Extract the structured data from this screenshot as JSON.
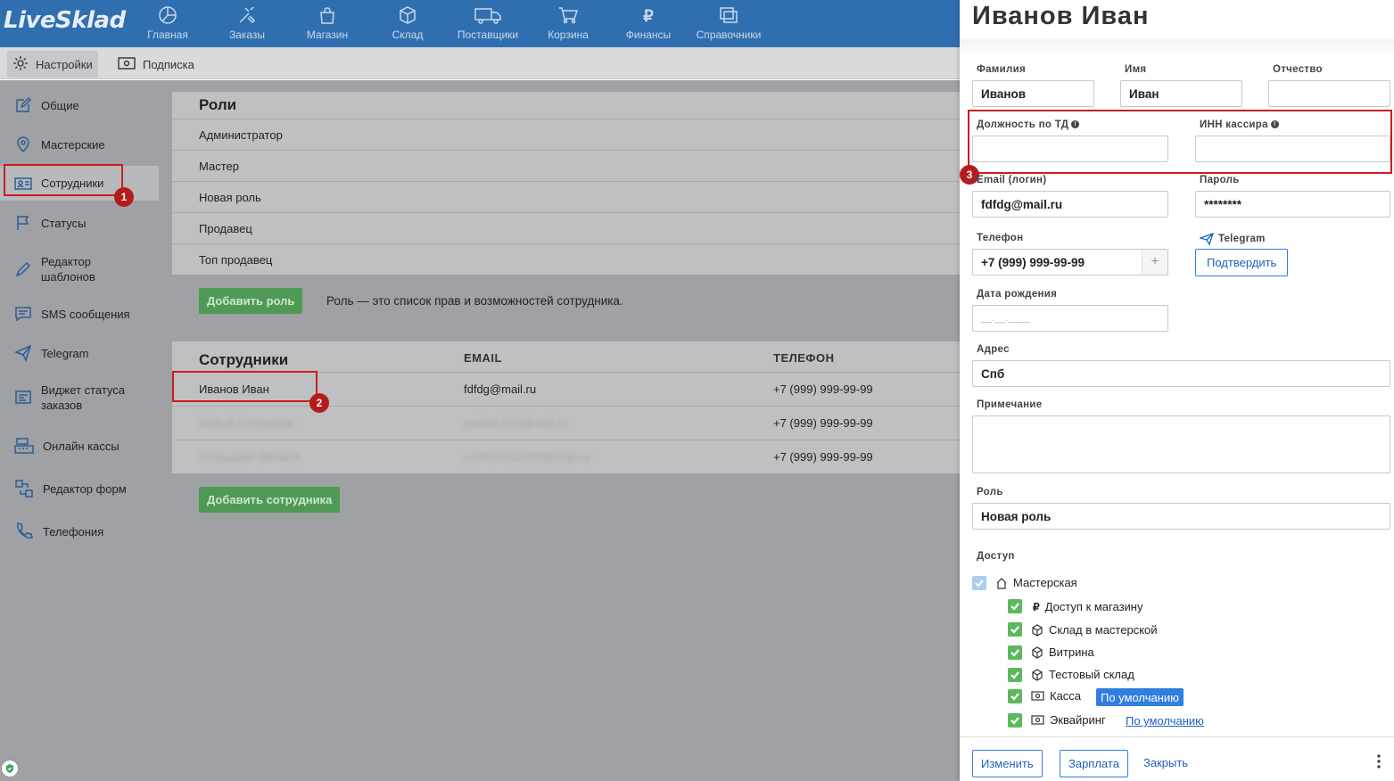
{
  "app": {
    "logo": "LiveSklad"
  },
  "nav": [
    {
      "label": "Главная",
      "icon": "pie-chart-icon"
    },
    {
      "label": "Заказы",
      "icon": "tools-icon"
    },
    {
      "label": "Магазин",
      "icon": "bag-icon"
    },
    {
      "label": "Склад",
      "icon": "box-icon"
    },
    {
      "label": "Поставщики",
      "icon": "truck-icon"
    },
    {
      "label": "Корзина",
      "icon": "cart-icon"
    },
    {
      "label": "Финансы",
      "icon": "ruble-icon"
    },
    {
      "label": "Справочники",
      "icon": "copy-icon"
    }
  ],
  "subtabs": [
    {
      "label": "Настройки",
      "icon": "gear-icon"
    },
    {
      "label": "Подписка",
      "icon": "banknote-icon"
    }
  ],
  "sidebar": [
    {
      "label": "Общие",
      "icon": "edit-icon"
    },
    {
      "label": "Мастерские",
      "icon": "map-pin-icon"
    },
    {
      "label": "Сотрудники",
      "icon": "id-card-icon"
    },
    {
      "label": "Статусы",
      "icon": "flag-icon"
    },
    {
      "label": "Редактор шаблонов",
      "icon": "pen-icon"
    },
    {
      "label": "SMS сообщения",
      "icon": "message-icon"
    },
    {
      "label": "Telegram",
      "icon": "send-icon"
    },
    {
      "label": "Виджет статуса заказов",
      "icon": "widget-icon"
    },
    {
      "label": "Онлайн кассы",
      "icon": "register-icon"
    },
    {
      "label": "Редактор форм",
      "icon": "form-icon"
    },
    {
      "label": "Телефония",
      "icon": "phone-icon"
    }
  ],
  "roles": {
    "title": "Роли",
    "items": [
      "Администратор",
      "Мастер",
      "Новая роль",
      "Продавец",
      "Топ продавец"
    ],
    "add_button": "Добавить роль",
    "help": "Роль — это список прав и возможностей сотрудника."
  },
  "employees": {
    "title": "Сотрудники",
    "col_email": "EMAIL",
    "col_phone": "ТЕЛЕФОН",
    "rows": [
      {
        "name": "Иванов Иван",
        "email": "fdfdg@mail.ru",
        "phone": "+7 (999) 999-99-99"
      },
      {
        "name": "Новый Сотрудник",
        "email": "yurima.123@mail.ru",
        "phone": "+7 (999) 999-99-99"
      },
      {
        "name": "Сотрудник Михаил",
        "email": "yurimovna1330@mail.ru",
        "phone": "+7 (999) 999-99-99"
      }
    ],
    "add_button": "Добавить сотрудника"
  },
  "badges": [
    "1",
    "2",
    "3"
  ],
  "panel": {
    "title": "Иванов Иван",
    "last_name_label": "Фамилия",
    "last_name": "Иванов",
    "first_name_label": "Имя",
    "first_name": "Иван",
    "middle_name_label": "Отчество",
    "middle_name": "",
    "position_label": "Должность по ТД",
    "inn_label": "ИНН кассира",
    "email_label": "Email (логин)",
    "email": "fdfdg@mail.ru",
    "password_label": "Пароль",
    "password": "********",
    "phone_label": "Телефон",
    "phone": "+7 (999) 999-99-99",
    "telegram_label": "Telegram",
    "confirm_button": "Подтвердить",
    "birth_label": "Дата рождения",
    "birth_placeholder": "__.__.____",
    "address_label": "Адрес",
    "address": "Спб",
    "note_label": "Примечание",
    "role_label": "Роль",
    "role": "Новая роль",
    "access_label": "Доступ",
    "access": {
      "workshop": "Мастерская",
      "items": [
        {
          "label": "Доступ к магазину",
          "icon": "ruble-icon"
        },
        {
          "label": "Склад в мастерской",
          "icon": "box-icon"
        },
        {
          "label": "Витрина",
          "icon": "box-icon"
        },
        {
          "label": "Тестовый склад",
          "icon": "box-icon"
        },
        {
          "label": "Касса",
          "icon": "banknote-icon"
        },
        {
          "label": "Эквайринг",
          "icon": "banknote-icon"
        }
      ],
      "default_pill": "По умолчанию",
      "default_link": "По умолчанию"
    },
    "footer": {
      "edit": "Изменить",
      "salary": "Зарплата",
      "close": "Закрыть"
    }
  },
  "colors": {
    "topbar": "#2f6fb0",
    "accent": "#2f7ee0",
    "green": "#4e9a55",
    "highlight": "#c81e1e"
  }
}
